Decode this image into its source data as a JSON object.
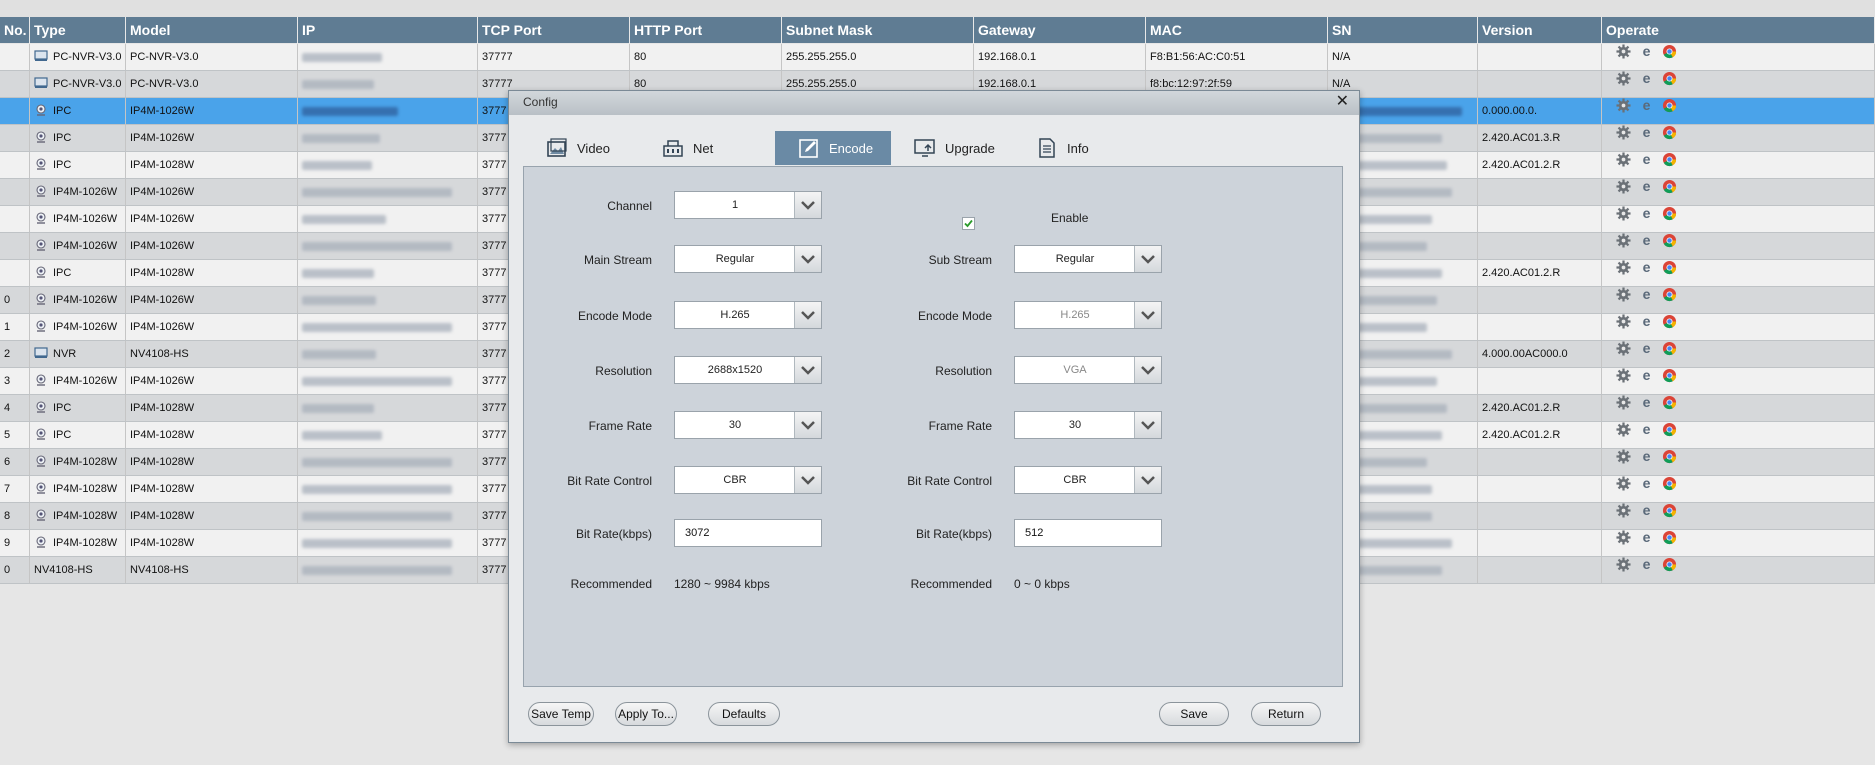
{
  "table": {
    "headers": [
      "No.",
      "Type",
      "Model",
      "IP",
      "TCP Port",
      "HTTP Port",
      "Subnet Mask",
      "Gateway",
      "MAC",
      "SN",
      "Version",
      "Operate"
    ],
    "rows": [
      {
        "no": "",
        "type": "PC-NVR-V3.0",
        "model": "PC-NVR-V3.0",
        "tcp": "37777",
        "http": "80",
        "mask": "255.255.255.0",
        "gateway": "192.168.0.1",
        "mac": "F8:B1:56:AC:C0:51",
        "sn": "N/A",
        "version": "",
        "icon": "nvr-icon"
      },
      {
        "no": "",
        "type": "PC-NVR-V3.0",
        "model": "PC-NVR-V3.0",
        "tcp": "37777",
        "http": "80",
        "mask": "255.255.255.0",
        "gateway": "192.168.0.1",
        "mac": "f8:bc:12:97:2f:59",
        "sn": "N/A",
        "version": "",
        "icon": "nvr-icon"
      },
      {
        "no": "",
        "type": "IPC",
        "model": "IP4M-1026W",
        "tcp": "3777",
        "http": "",
        "mask": "",
        "gateway": "",
        "mac": "",
        "sn": "",
        "version": "0.000.00.0.",
        "icon": "camera-icon",
        "selected": true
      },
      {
        "no": "",
        "type": "IPC",
        "model": "IP4M-1026W",
        "tcp": "3777",
        "http": "",
        "mask": "",
        "gateway": "",
        "mac": "",
        "sn": "",
        "version": "2.420.AC01.3.R",
        "icon": "camera-icon"
      },
      {
        "no": "",
        "type": "IPC",
        "model": "IP4M-1028W",
        "tcp": "3777",
        "http": "",
        "mask": "",
        "gateway": "",
        "mac": "",
        "sn": "",
        "version": "2.420.AC01.2.R",
        "icon": "camera-icon"
      },
      {
        "no": "",
        "type": "IP4M-1026W",
        "model": "IP4M-1026W",
        "tcp": "3777",
        "http": "",
        "mask": "",
        "gateway": "",
        "mac": "",
        "sn": "",
        "version": "",
        "icon": "camera-icon"
      },
      {
        "no": "",
        "type": "IP4M-1026W",
        "model": "IP4M-1026W",
        "tcp": "3777",
        "http": "",
        "mask": "",
        "gateway": "",
        "mac": "",
        "sn": "",
        "version": "",
        "icon": "camera-icon"
      },
      {
        "no": "",
        "type": "IP4M-1026W",
        "model": "IP4M-1026W",
        "tcp": "3777",
        "http": "",
        "mask": "",
        "gateway": "",
        "mac": "",
        "sn": "",
        "version": "",
        "icon": "camera-icon"
      },
      {
        "no": "",
        "type": "IPC",
        "model": "IP4M-1028W",
        "tcp": "3777",
        "http": "",
        "mask": "",
        "gateway": "",
        "mac": "",
        "sn": "",
        "version": "2.420.AC01.2.R",
        "icon": "camera-icon"
      },
      {
        "no": "0",
        "type": "IP4M-1026W",
        "model": "IP4M-1026W",
        "tcp": "3777",
        "http": "",
        "mask": "",
        "gateway": "",
        "mac": "",
        "sn": "",
        "version": "",
        "icon": "camera-icon"
      },
      {
        "no": "1",
        "type": "IP4M-1026W",
        "model": "IP4M-1026W",
        "tcp": "3777",
        "http": "",
        "mask": "",
        "gateway": "",
        "mac": "",
        "sn": "",
        "version": "",
        "icon": "camera-icon"
      },
      {
        "no": "2",
        "type": "NVR",
        "model": "NV4108-HS",
        "tcp": "3777",
        "http": "",
        "mask": "",
        "gateway": "",
        "mac": "",
        "sn": "",
        "version": "4.000.00AC000.0",
        "icon": "nvr-icon"
      },
      {
        "no": "3",
        "type": "IP4M-1026W",
        "model": "IP4M-1026W",
        "tcp": "3777",
        "http": "",
        "mask": "",
        "gateway": "",
        "mac": "",
        "sn": "",
        "version": "",
        "icon": "camera-icon"
      },
      {
        "no": "4",
        "type": "IPC",
        "model": "IP4M-1028W",
        "tcp": "3777",
        "http": "",
        "mask": "",
        "gateway": "",
        "mac": "",
        "sn": "",
        "version": "2.420.AC01.2.R",
        "icon": "camera-icon"
      },
      {
        "no": "5",
        "type": "IPC",
        "model": "IP4M-1028W",
        "tcp": "3777",
        "http": "",
        "mask": "",
        "gateway": "",
        "mac": "",
        "sn": "",
        "version": "2.420.AC01.2.R",
        "icon": "camera-icon"
      },
      {
        "no": "6",
        "type": "IP4M-1028W",
        "model": "IP4M-1028W",
        "tcp": "3777",
        "http": "",
        "mask": "",
        "gateway": "",
        "mac": "",
        "sn": "",
        "version": "",
        "icon": "camera-icon"
      },
      {
        "no": "7",
        "type": "IP4M-1028W",
        "model": "IP4M-1028W",
        "tcp": "3777",
        "http": "",
        "mask": "",
        "gateway": "",
        "mac": "",
        "sn": "",
        "version": "",
        "icon": "camera-icon"
      },
      {
        "no": "8",
        "type": "IP4M-1028W",
        "model": "IP4M-1028W",
        "tcp": "3777",
        "http": "",
        "mask": "",
        "gateway": "",
        "mac": "",
        "sn": "",
        "version": "",
        "icon": "camera-icon"
      },
      {
        "no": "9",
        "type": "IP4M-1028W",
        "model": "IP4M-1028W",
        "tcp": "3777",
        "http": "",
        "mask": "",
        "gateway": "",
        "mac": "",
        "sn": "",
        "version": "",
        "icon": "camera-icon"
      },
      {
        "no": "0",
        "type": "NV4108-HS",
        "model": "NV4108-HS",
        "tcp": "3777",
        "http": "",
        "mask": "",
        "gateway": "",
        "mac": "",
        "sn": "",
        "version": "",
        "icon": ""
      }
    ]
  },
  "dialog": {
    "title": "Config",
    "close_icon": "close-icon",
    "tabs": [
      {
        "label": "Video",
        "icon": "video-image-icon"
      },
      {
        "label": "Net",
        "icon": "network-icon"
      },
      {
        "label": "Encode",
        "icon": "encode-edit-icon",
        "active": true
      },
      {
        "label": "Upgrade",
        "icon": "upgrade-monitor-icon"
      },
      {
        "label": "Info",
        "icon": "info-document-icon"
      }
    ],
    "main": {
      "channel_label": "Channel",
      "channel_value": "1",
      "stream_label": "Main Stream",
      "stream_value": "Regular",
      "encode_label": "Encode Mode",
      "encode_value": "H.265",
      "resolution_label": "Resolution",
      "resolution_value": "2688x1520",
      "framerate_label": "Frame Rate",
      "framerate_value": "30",
      "brc_label": "Bit Rate Control",
      "brc_value": "CBR",
      "bitrate_label": "Bit Rate(kbps)",
      "bitrate_value": "3072",
      "recommended_label": "Recommended",
      "recommended_value": "1280 ~ 9984 kbps"
    },
    "sub": {
      "enable_label": "Enable",
      "enabled": true,
      "stream_label": "Sub Stream",
      "stream_value": "Regular",
      "encode_label": "Encode Mode",
      "encode_value": "H.265",
      "resolution_label": "Resolution",
      "resolution_value": "VGA",
      "framerate_label": "Frame Rate",
      "framerate_value": "30",
      "brc_label": "Bit Rate Control",
      "brc_value": "CBR",
      "bitrate_label": "Bit Rate(kbps)",
      "bitrate_value": "512",
      "recommended_label": "Recommended",
      "recommended_value": "0 ~ 0 kbps"
    },
    "buttons": {
      "save_temp": "Save Temp",
      "apply_to": "Apply To...",
      "defaults": "Defaults",
      "save": "Save",
      "return": "Return"
    }
  }
}
